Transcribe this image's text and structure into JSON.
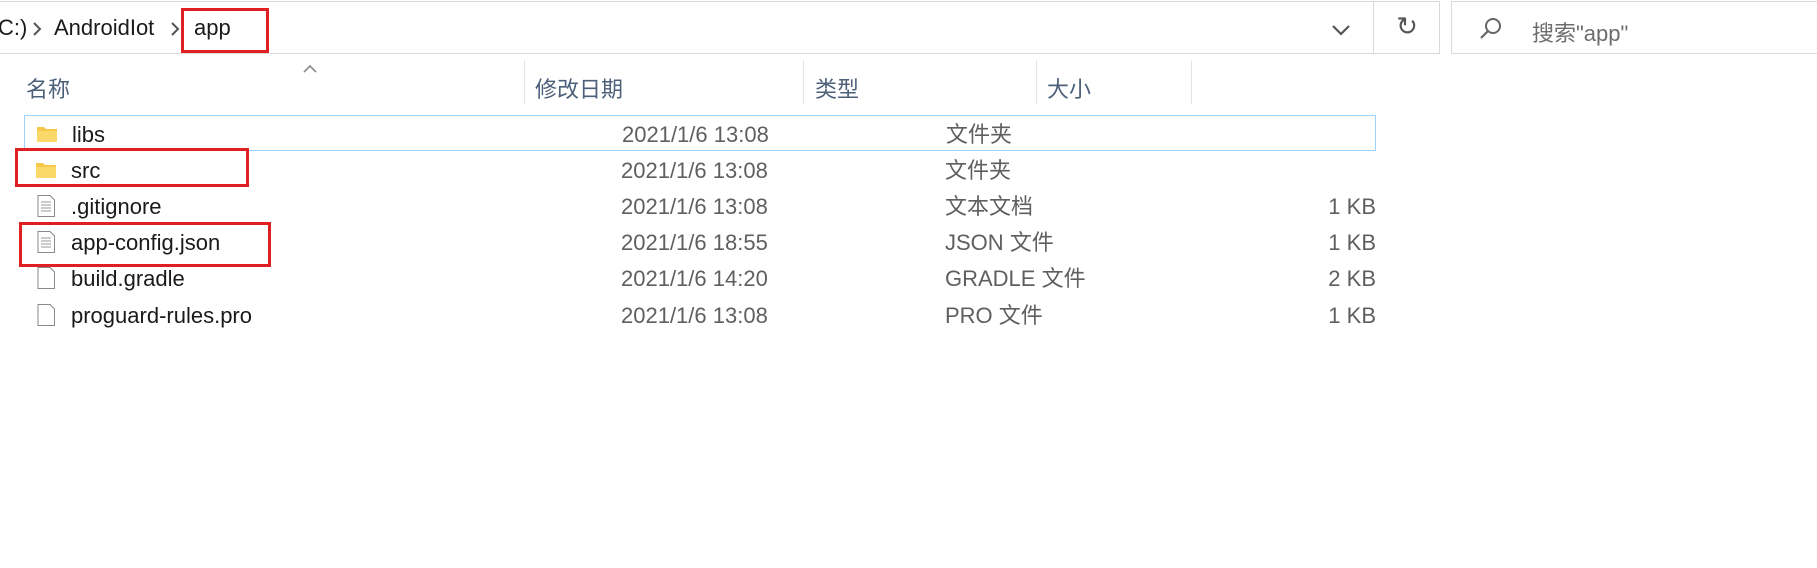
{
  "breadcrumb": {
    "drive_fragment": "C:)",
    "folder": "AndroidIot",
    "current": "app"
  },
  "search": {
    "placeholder": "搜索\"app\""
  },
  "columns": {
    "name": "名称",
    "date": "修改日期",
    "type": "类型",
    "size": "大小"
  },
  "files": [
    {
      "name": "libs",
      "date": "2021/1/6 13:08",
      "type": "文件夹",
      "size": "",
      "icon": "folder-icon"
    },
    {
      "name": "src",
      "date": "2021/1/6 13:08",
      "type": "文件夹",
      "size": "",
      "icon": "folder-icon"
    },
    {
      "name": ".gitignore",
      "date": "2021/1/6 13:08",
      "type": "文本文档",
      "size": "1 KB",
      "icon": "text-file-icon"
    },
    {
      "name": "app-config.json",
      "date": "2021/1/6 18:55",
      "type": "JSON 文件",
      "size": "1 KB",
      "icon": "text-file-icon"
    },
    {
      "name": "build.gradle",
      "date": "2021/1/6 14:20",
      "type": "GRADLE 文件",
      "size": "2 KB",
      "icon": "blank-file-icon"
    },
    {
      "name": "proguard-rules.pro",
      "date": "2021/1/6 13:08",
      "type": "PRO 文件",
      "size": "1 KB",
      "icon": "blank-file-icon"
    }
  ],
  "colors": {
    "highlight": "#e02020",
    "selection_border": "#99d1ff",
    "folder": "#f7c948",
    "header_text": "#4c607a"
  }
}
